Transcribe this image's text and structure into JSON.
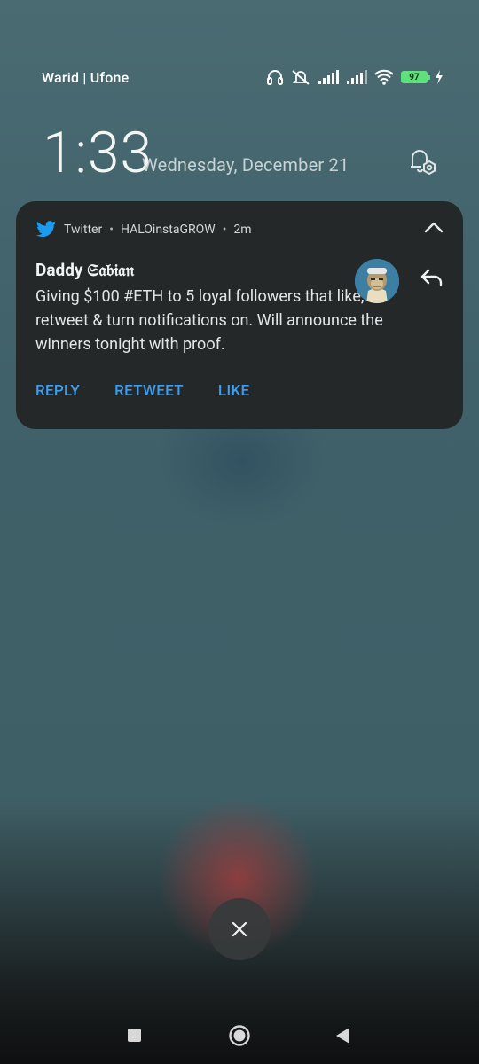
{
  "status_bar": {
    "carrier": "Warid | Ufone",
    "battery_level": "97",
    "icons": [
      "headphones-icon",
      "mute-icon",
      "signal-icon",
      "signal-icon",
      "wifi-icon",
      "battery-icon",
      "charging-icon"
    ]
  },
  "lockscreen": {
    "time": "1:33",
    "date": "Wednesday, December 21"
  },
  "notification": {
    "app": "Twitter",
    "account": "HALOinstaGROW",
    "age": "2m",
    "separator": "•",
    "sender": "Daddy 𝔖𝔞𝔟𝔦𝔞𝔫",
    "body": "Giving $100 #ETH to 5 loyal followers that like, retweet & turn notifications on. Will announce the winners tonight with proof.",
    "actions": [
      "REPLY",
      "RETWEET",
      "LIKE"
    ],
    "accent_color": "#3d9df0"
  },
  "icons": {
    "app": "twitter-bird-icon",
    "collapse": "chevron-up-icon",
    "quick_reply": "reply-arrow-icon",
    "dismiss": "close-icon",
    "nav": [
      "recents-square-icon",
      "home-circle-icon",
      "back-triangle-icon"
    ]
  }
}
